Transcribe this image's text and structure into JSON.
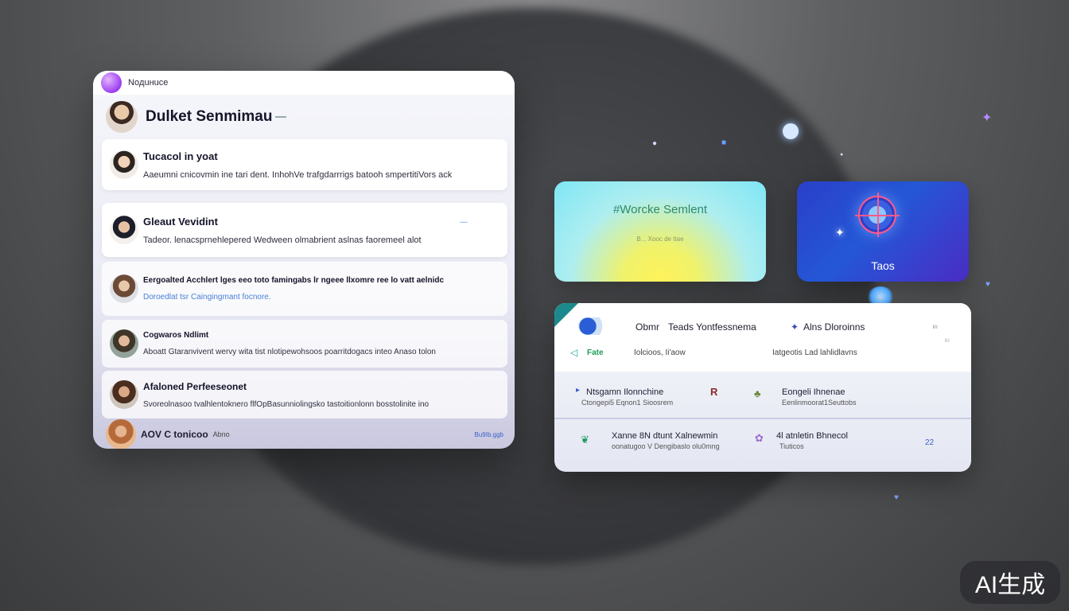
{
  "left_panel": {
    "topbar_title": "Noдuнuce",
    "header_title": "Dulket Senmimau",
    "cards": [
      {
        "title": "Tucacol in yoat",
        "desc": "Aaeumni cnicovmin ine tari dent. InhohVe trafgdarrrigs batooh smpertitiVors ack"
      },
      {
        "title": "Gleaut Vevidint",
        "desc": "Tadeor. lenacsprnehlepered Wedween  olmabrient aslnas faoremeel alot",
        "tag": "╌╌"
      },
      {
        "title": "Eergoalted Acchlert  lges eeo toto famingabs lr ngeee llxomre ree lo vatt aelnidc",
        "desc": "Doroedlat tsr Caingingmant focnore."
      },
      {
        "title": "Cogwaros Ndlimt",
        "desc": "Aboatt Gtaranvivent wervy wita tist nlotipewohsoos poarritdogacs inteo  Anaso tolon"
      },
      {
        "title": "Afaloned Perfeeseonet",
        "desc": "Svoreolnasoo tvalhlentoknero flfOpBasunniolingsko tastoitionlonn bosstolinite ino"
      }
    ],
    "footer_label": "AOV C tonicoo",
    "footer_sub": "Abno",
    "footer_link": "Bu9Ib.ggb"
  },
  "tile_sentiment": {
    "title": "#Worcke Semlent",
    "sub": "B... Xooc de ttae"
  },
  "tile_taos": {
    "label": "Taos"
  },
  "table_card": {
    "header": {
      "col1": "Obmr",
      "col2": "Teads Yontfessnema",
      "col3": "Alns Dloroinns",
      "fate": "Fate",
      "sub2": "Iolcioos, Ii'aow",
      "sub3": "Iatgeotis Lad lahlidlavns",
      "num1": "ııı",
      "num2": "ııı"
    },
    "rows": [
      {
        "a_title": "Ntsgamn  Ilonnchine",
        "a_sub": "Ctongepi5 Eqnon1 Sioosrem",
        "b_title": "Eongeli Ihnenae",
        "b_sub": "Eenlinmoorat1Seuttobs",
        "num": ""
      },
      {
        "a_title": "Xanne 8N dtunt  Xalnewmin",
        "a_sub": "oonatugoo V Dengibaslo olu0mng",
        "b_title": "4l atnletin Bhnecol",
        "b_sub": "Tiuticos",
        "num": "22"
      }
    ]
  },
  "watermark": "AI生成",
  "colors": {
    "accent_teal": "#1c8a8c",
    "accent_blue": "#2457d6",
    "link_blue": "#4a7fd6"
  }
}
